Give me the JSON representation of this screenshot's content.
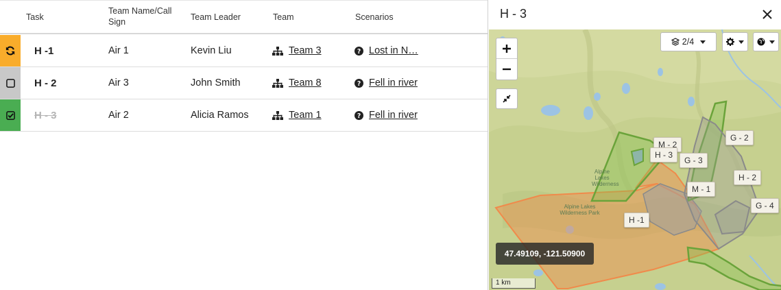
{
  "table": {
    "headers": {
      "task": "Task",
      "team_name": "Team Name/Call Sign",
      "team_leader": "Team Leader",
      "team": "Team",
      "scenarios": "Scenarios"
    },
    "rows": [
      {
        "status": "in-progress",
        "status_color": "#f9ac2b",
        "task": "H -1",
        "call_sign": "Air 1",
        "leader": "Kevin Liu",
        "team": "Team 3",
        "scenario": "Lost in N…"
      },
      {
        "status": "pending",
        "status_color": "#c8c8c8",
        "task": "H - 2",
        "call_sign": "Air 3",
        "leader": "John Smith",
        "team": "Team 8",
        "scenario": "Fell in river"
      },
      {
        "status": "complete",
        "status_color": "#4aad52",
        "task": "H - 3",
        "call_sign": "Air 2",
        "leader": "Alicia Ramos",
        "team": "Team 1",
        "scenario": "Fell in river"
      }
    ]
  },
  "detail": {
    "title": "H - 3",
    "map": {
      "layers_label": "2/4",
      "coordinates": "47.49109, -121.50900",
      "scale_label": "1 km",
      "place_labels": {
        "wilderness": "Alpine\nLakes\nWilderness",
        "park": "Alpine Lakes\nWilderness Park"
      },
      "segments": {
        "m2": "M - 2",
        "h3": "H - 3",
        "g3": "G - 3",
        "g2": "G - 2",
        "h2": "H - 2",
        "m1": "M - 1",
        "g4": "G - 4",
        "h1": "H -1"
      }
    }
  },
  "colors": {
    "in_progress": "#f9ac2b",
    "pending": "#c8c8c8",
    "complete": "#4aad52",
    "segment_orange": "#f08a4b",
    "segment_green": "#6aa33a",
    "segment_gray": "#8a8a8a"
  },
  "icons": {
    "in_progress": "refresh-icon",
    "pending": "checkbox-empty-icon",
    "complete": "checkbox-checked-icon",
    "team": "sitemap-icon",
    "scenario": "question-circle-icon",
    "close": "close-icon",
    "layers": "layers-icon",
    "settings": "gear-icon",
    "globe": "globe-icon",
    "collapse": "compress-icon"
  }
}
